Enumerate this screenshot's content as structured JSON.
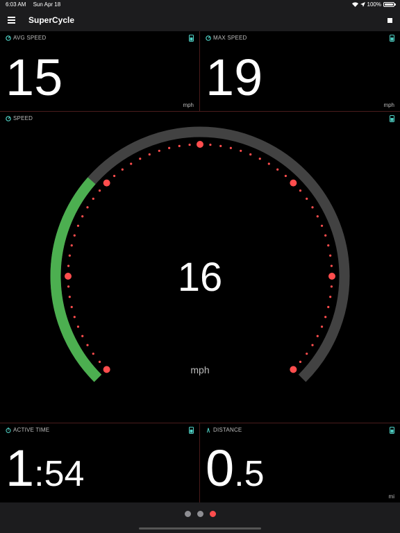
{
  "status_bar": {
    "time": "6:03 AM",
    "date": "Sun Apr 18",
    "battery": "100%"
  },
  "nav": {
    "title": "SuperCycle"
  },
  "tiles": {
    "avg_speed": {
      "label": "AVG SPEED",
      "value": "15",
      "unit": "mph"
    },
    "max_speed": {
      "label": "MAX SPEED",
      "value": "19",
      "unit": "mph"
    },
    "speed": {
      "label": "SPEED",
      "value": "16",
      "unit": "mph"
    },
    "active_time": {
      "label": "ACTIVE TIME",
      "value_major": "1",
      "value_minor": ":54"
    },
    "distance": {
      "label": "DISTANCE",
      "value_major": "0",
      "value_minor": ".5",
      "unit": "mi"
    }
  },
  "gauge": {
    "fraction": 0.32
  },
  "pager": {
    "pages": 3,
    "active": 2
  },
  "colors": {
    "accent_green": "#4caf50",
    "dot_red": "#ff4d4d",
    "track_gray": "#424242",
    "icon_teal": "#4fd1c5"
  }
}
